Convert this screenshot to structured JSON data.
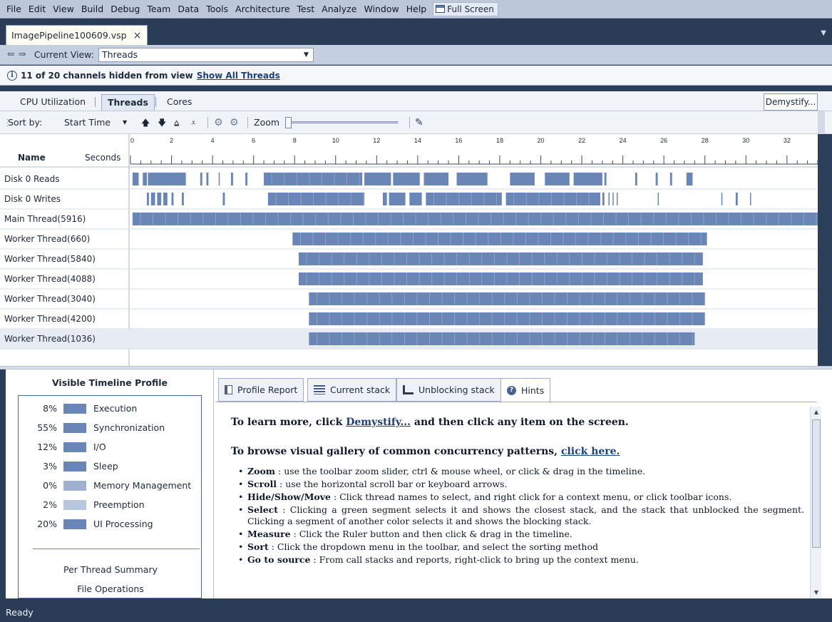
{
  "menu": {
    "items": [
      "File",
      "Edit",
      "View",
      "Build",
      "Debug",
      "Team",
      "Data",
      "Tools",
      "Architecture",
      "Test",
      "Analyze",
      "Window",
      "Help"
    ],
    "fullscreen_label": "Full Screen"
  },
  "document_tab": {
    "title": "ImagePipeline100609.vsp",
    "close": "×"
  },
  "view_bar": {
    "back": "⇚",
    "forward": "⇛",
    "label": "Current View:",
    "selected": "Threads"
  },
  "info_bar": {
    "message": "11 of 20  channels hidden from view",
    "link": "Show All Threads"
  },
  "view_tabs": {
    "tabs": [
      "CPU Utilization",
      "Threads",
      "Cores"
    ],
    "active": "Threads",
    "demystify": "Demystify..."
  },
  "toolbar": {
    "sort_label": "Sort by:",
    "sort_value": "Start Time",
    "zoom_label": "Zoom",
    "zoom_level": 0.03
  },
  "timeline": {
    "name_header": "Name",
    "seconds_header": "Seconds",
    "axis_ticks": [
      "0",
      "2",
      "4",
      "6",
      "8",
      "10",
      "12",
      "14",
      "16",
      "18",
      "20",
      "22",
      "24",
      "26",
      "28",
      "30",
      "32"
    ],
    "axis_range_seconds": [
      0,
      33.5
    ],
    "bar_color": "#6a86b6",
    "selected_row_color": "#e7ecf4",
    "threads": [
      {
        "name": "Disk 0 Reads",
        "segments": [
          [
            0.1,
            0.4
          ],
          [
            0.6,
            0.8
          ],
          [
            0.85,
            2.7
          ],
          [
            3.4,
            3.5
          ],
          [
            3.7,
            3.8
          ],
          [
            4.3,
            4.35
          ],
          [
            4.9,
            5.0
          ],
          [
            5.6,
            5.7
          ],
          [
            6.5,
            11.3
          ],
          [
            11.4,
            12.7
          ],
          [
            12.8,
            14.1
          ],
          [
            14.3,
            15.5
          ],
          [
            15.9,
            17.4
          ],
          [
            18.5,
            19.7
          ],
          [
            20.2,
            21.4
          ],
          [
            21.6,
            23.0
          ],
          [
            23.1,
            23.2
          ],
          [
            24.6,
            24.7
          ],
          [
            25.6,
            25.7
          ],
          [
            26.3,
            26.4
          ],
          [
            27.1,
            27.4
          ]
        ]
      },
      {
        "name": "Disk 0 Writes",
        "segments": [
          [
            0.8,
            0.9
          ],
          [
            1.0,
            1.2
          ],
          [
            1.3,
            1.5
          ],
          [
            1.6,
            1.8
          ],
          [
            2.0,
            2.1
          ],
          [
            2.5,
            2.6
          ],
          [
            4.5,
            4.6
          ],
          [
            6.7,
            11.4
          ],
          [
            12.3,
            12.5
          ],
          [
            12.6,
            13.4
          ],
          [
            13.6,
            14.2
          ],
          [
            14.4,
            18.1
          ],
          [
            18.3,
            22.9
          ],
          [
            23.0,
            23.1
          ],
          [
            23.3,
            23.35
          ],
          [
            23.5,
            23.55
          ],
          [
            23.7,
            23.75
          ],
          [
            25.7,
            25.75
          ],
          [
            28.8,
            28.85
          ],
          [
            29.5,
            29.6
          ],
          [
            30.2,
            30.25
          ]
        ]
      },
      {
        "name": "Main Thread(5916)",
        "segments": [
          [
            0.1,
            33.5
          ]
        ]
      },
      {
        "name": "Worker Thread(660)",
        "segments": [
          [
            7.9,
            28.1
          ]
        ]
      },
      {
        "name": "Worker Thread(5840)",
        "segments": [
          [
            8.2,
            27.9
          ]
        ]
      },
      {
        "name": "Worker Thread(4088)",
        "segments": [
          [
            8.2,
            27.9
          ]
        ]
      },
      {
        "name": "Worker Thread(3040)",
        "segments": [
          [
            8.7,
            28.0
          ]
        ]
      },
      {
        "name": "Worker Thread(4200)",
        "segments": [
          [
            8.7,
            28.0
          ]
        ]
      },
      {
        "name": "Worker Thread(1036)",
        "segments": [
          [
            8.7,
            27.5
          ]
        ]
      }
    ],
    "selected_row": "Worker Thread(1036)"
  },
  "profile": {
    "title": "Visible Timeline Profile",
    "categories": [
      {
        "pct": "8%",
        "label": "Execution",
        "color": "#6a86b6"
      },
      {
        "pct": "55%",
        "label": "Synchronization",
        "color": "#6a86b6"
      },
      {
        "pct": "12%",
        "label": "I/O",
        "color": "#6a86b6"
      },
      {
        "pct": "3%",
        "label": "Sleep",
        "color": "#6a86b6"
      },
      {
        "pct": "0%",
        "label": "Memory Management",
        "color": "#9fb1d0"
      },
      {
        "pct": "2%",
        "label": "Preemption",
        "color": "#b8c6de"
      },
      {
        "pct": "20%",
        "label": "UI Processing",
        "color": "#6a86b6"
      }
    ],
    "per_thread": "Per Thread Summary",
    "file_ops": "File Operations"
  },
  "hint_tabs": [
    "Profile Report",
    "Current stack",
    "Unblocking stack",
    "Hints"
  ],
  "hints": {
    "line1_a": "To learn more, click ",
    "line1_link": "Demystify...",
    "line1_b": " and then click any item on the screen.",
    "line2_a": "To browse visual gallery of common concurrency patterns, ",
    "line2_link": "click here.",
    "items": [
      {
        "term": "Zoom",
        "text": " : use the toolbar zoom slider, ctrl & mouse wheel, or click & drag in the timeline."
      },
      {
        "term": "Scroll",
        "text": " : use the horizontal scroll bar or keyboard arrows."
      },
      {
        "term": "Hide/Show/Move",
        "text": " : Click thread names to select, and right click for a context menu, or click toolbar icons."
      },
      {
        "term": "Select",
        "text": " : Clicking a green segment selects it and shows the closest stack, and the stack that unblocked the segment. Clicking a segment of another color selects it and shows the blocking stack."
      },
      {
        "term": "Measure",
        "text": " : Click the Ruler button and then click & drag in the timeline."
      },
      {
        "term": "Sort",
        "text": " : Click the dropdown menu in the toolbar, and select the sorting method"
      },
      {
        "term": "Go to source",
        "text": " : From call stacks and reports, right-click to bring up the context menu."
      }
    ]
  },
  "status": "Ready"
}
